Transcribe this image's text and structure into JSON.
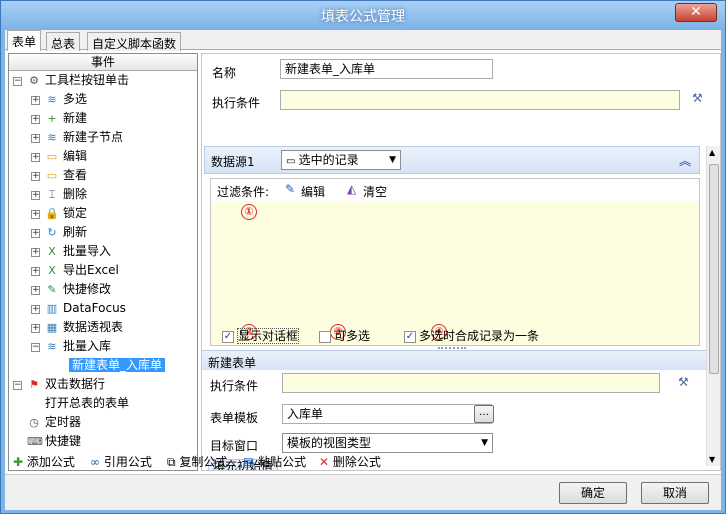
{
  "window": {
    "title": "填表公式管理",
    "close_glyph": "✕"
  },
  "tabs": [
    {
      "label": "表单"
    },
    {
      "label": "总表"
    },
    {
      "label": "自定义脚本函数"
    }
  ],
  "left": {
    "header": "事件",
    "tree": [
      {
        "label": "工具栏按钮单击",
        "icon": "gear-icon",
        "glyph": "⚙",
        "exp": "⊟"
      },
      {
        "label": "多选",
        "icon": "stack-icon",
        "glyph": "≋",
        "exp": "⊞"
      },
      {
        "label": "新建",
        "icon": "plus-circle-icon",
        "glyph": "+",
        "exp": "⊞"
      },
      {
        "label": "新建子节点",
        "icon": "stack-icon",
        "glyph": "≋",
        "exp": "⊞"
      },
      {
        "label": "编辑",
        "icon": "folder-icon",
        "glyph": "▭",
        "exp": "⊞"
      },
      {
        "label": "查看",
        "icon": "folder-icon",
        "glyph": "▭",
        "exp": "⊞"
      },
      {
        "label": "删除",
        "icon": "delete-icon",
        "glyph": "⌶",
        "exp": "⊞"
      },
      {
        "label": "锁定",
        "icon": "lock-icon",
        "glyph": "🔒",
        "exp": "⊞"
      },
      {
        "label": "刷新",
        "icon": "refresh-icon",
        "glyph": "↻",
        "exp": "⊞"
      },
      {
        "label": "批量导入",
        "icon": "excel-icon",
        "glyph": "X",
        "exp": "⊞"
      },
      {
        "label": "导出Excel",
        "icon": "excel-icon",
        "glyph": "X",
        "exp": "⊞"
      },
      {
        "label": "快捷修改",
        "icon": "edit-icon",
        "glyph": "✎",
        "exp": "⊞"
      },
      {
        "label": "DataFocus",
        "icon": "chart-icon",
        "glyph": "▥",
        "exp": "⊞"
      },
      {
        "label": "数据透视表",
        "icon": "grid-icon",
        "glyph": "▦",
        "exp": "⊞"
      },
      {
        "label": "批量入库",
        "icon": "stack-icon",
        "glyph": "≋",
        "exp": "⊟"
      },
      {
        "label": "新建表单_入库单",
        "icon": "",
        "glyph": "",
        "exp": ""
      },
      {
        "label": "双击数据行",
        "icon": "flag-icon",
        "glyph": "⚑",
        "exp": "⊟"
      },
      {
        "label": "打开总表的表单",
        "icon": "",
        "glyph": "",
        "exp": ""
      },
      {
        "label": "定时器",
        "icon": "timer-icon",
        "glyph": "◷",
        "exp": ""
      },
      {
        "label": "快捷键",
        "icon": "keyboard-icon",
        "glyph": "⌨",
        "exp": ""
      }
    ]
  },
  "right": {
    "name_label": "名称",
    "name_value": "新建表单_入库单",
    "cond_label": "执行条件",
    "cond_value": "",
    "ds_label": "数据源1",
    "ds_select": "选中的记录",
    "filter_label": "过滤条件:",
    "edit_label": "编辑",
    "clear_label": "清空",
    "markers": [
      "①",
      "②",
      "③",
      "④"
    ],
    "show_dialog_label": "显示对话框",
    "multi_label": "可多选",
    "merge_label": "多选时合成记录为一条",
    "show_dialog_checked": "✓",
    "multi_checked": "",
    "merge_checked": "✓",
    "section_title": "新建表单",
    "sub_cond_label": "执行条件",
    "sub_cond_value": "",
    "template_label": "表单模板",
    "template_value": "入库单",
    "target_label": "目标窗口",
    "target_value": "模板的视图类型",
    "fill_label": "填充初始值"
  },
  "toolbar": {
    "add": "添加公式",
    "ref": "引用公式",
    "copy": "复制公式",
    "paste": "粘贴公式",
    "del": "删除公式"
  },
  "footer": {
    "ok": "确定",
    "cancel": "取消"
  },
  "colors": {
    "accent": "#3399ff",
    "marker": "#e0282c",
    "titlebar": "#7eb2e6"
  }
}
